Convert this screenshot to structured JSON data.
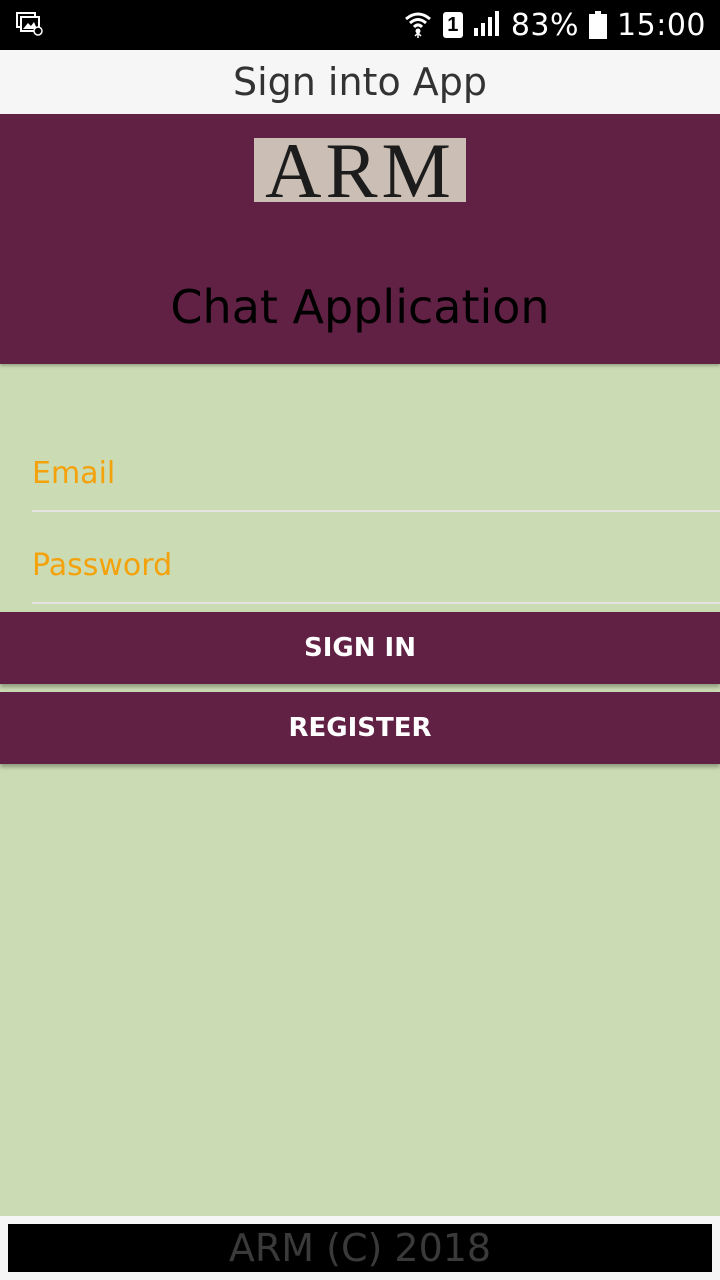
{
  "status_bar": {
    "battery": "83%",
    "time": "15:00",
    "sim_slot": "1",
    "icons": [
      "notification-gallery-icon",
      "wifi-icon",
      "sim-icon",
      "signal-icon",
      "battery-icon"
    ]
  },
  "action_bar": {
    "title": "Sign into App"
  },
  "header": {
    "logo_text": "ARM",
    "app_title": "Chat Application",
    "background_color": "#612145"
  },
  "form": {
    "email_placeholder": "Email",
    "email_value": "",
    "password_placeholder": "Password",
    "password_value": "",
    "placeholder_color": "#f4a20c"
  },
  "buttons": {
    "sign_in_label": "SIGN IN",
    "register_label": "REGISTER"
  },
  "footer": {
    "text": "ARM (C) 2018"
  },
  "colors": {
    "page_background": "#cbdcb4",
    "accent": "#612145"
  }
}
